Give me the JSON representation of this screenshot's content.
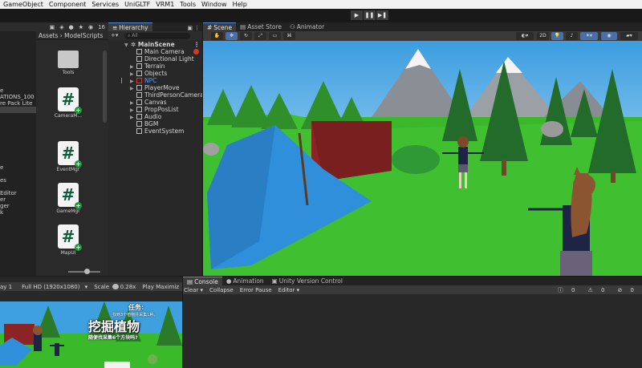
{
  "menu": [
    "GameObject",
    "Component",
    "Services",
    "UniGLTF",
    "VRM1",
    "Tools",
    "Window",
    "Help"
  ],
  "playbar": {
    "play": "▶",
    "pause": "❚❚",
    "step": "▶❚"
  },
  "project": {
    "count": "16",
    "breadcrumb": "Assets › ModelScripts",
    "sidebar": [
      "e",
      "ATIONS_100",
      "re Pack Lite",
      "",
      "",
      "",
      "e",
      "",
      "es",
      "",
      "Editor",
      "er",
      "ger",
      "k"
    ],
    "assets": [
      {
        "name": "Tools",
        "kind": "folder"
      },
      {
        "name": "CameraM...",
        "kind": "script"
      },
      {
        "name": "EventMgr",
        "kind": "script"
      },
      {
        "name": "GameMgr",
        "kind": "script"
      },
      {
        "name": "MapUI",
        "kind": "script"
      }
    ]
  },
  "hierarchy": {
    "tab": "Hierarchy",
    "search_placeholder": "All",
    "add": "+▾",
    "root": "MainScene",
    "items": [
      "Main Camera",
      "Directional Light",
      "Terrain",
      "Objects",
      "NPC",
      "PlayerMove",
      "ThirdPersonCamera",
      "Canvas",
      "PropPosList",
      "Audio",
      "BGM",
      "EventSystem"
    ]
  },
  "scene": {
    "tabs": [
      "Scene",
      "Asset Store",
      "Animator"
    ],
    "mode_2d": "2D"
  },
  "game": {
    "display": "ay 1",
    "resolution": "Full HD (1920x1080)",
    "scale_label": "Scale",
    "scale_value": "0.28x",
    "play_mode": "Play Maximiz",
    "task_title": "任务:",
    "big_title": "挖掘植物",
    "task_line1": "找到3个植物并采集1种。",
    "task_line2": "随便找采集6个方块吗?"
  },
  "console": {
    "tabs": [
      "Console",
      "Animation",
      "Unity Version Control"
    ],
    "clear": "Clear ▾",
    "collapse": "Collapse",
    "error_pause": "Error Pause",
    "editor": "Editor ▾",
    "counts": [
      "0",
      "0",
      "0"
    ]
  },
  "colors": {
    "accent": "#4a8ce8",
    "npc": "#5b9bff",
    "script_plus": "#1c9b3a",
    "sky": "#3fa0df",
    "grass": "#3aba2b"
  }
}
